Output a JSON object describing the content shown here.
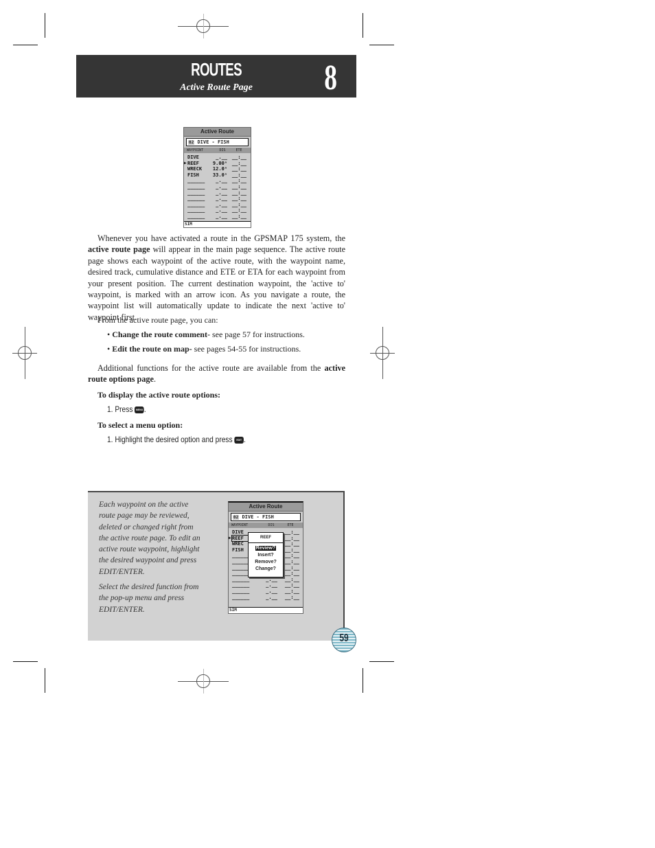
{
  "header": {
    "title": "ROUTES",
    "subtitle": "Active Route Page",
    "chapter_number": "8"
  },
  "screen1": {
    "title": "Active Route",
    "route_number": "02",
    "route_name": "DIVE  - FISH",
    "columns": [
      "WAYPOINT",
      "DIS",
      "ETE"
    ],
    "rows": [
      {
        "arrow": "",
        "name": "DIVE",
        "dis": "_.__",
        "ete": "__:__"
      },
      {
        "arrow": "▶",
        "name": "REEF",
        "dis": "9.00ⁿ",
        "ete": "__:__"
      },
      {
        "arrow": "",
        "name": "WRECK",
        "dis": "12.0ⁿ",
        "ete": "__:__"
      },
      {
        "arrow": "",
        "name": "FISH",
        "dis": "33.0ⁿ",
        "ete": "__:__"
      },
      {
        "arrow": "",
        "name": "______",
        "dis": "_.__",
        "ete": "__:__"
      },
      {
        "arrow": "",
        "name": "______",
        "dis": "_.__",
        "ete": "__:__"
      },
      {
        "arrow": "",
        "name": "______",
        "dis": "_.__",
        "ete": "__:__"
      },
      {
        "arrow": "",
        "name": "______",
        "dis": "_.__",
        "ete": "__:__"
      },
      {
        "arrow": "",
        "name": "______",
        "dis": "_.__",
        "ete": "__:__"
      },
      {
        "arrow": "",
        "name": "______",
        "dis": "_.__",
        "ete": "__:__"
      },
      {
        "arrow": "",
        "name": "______",
        "dis": "_.__",
        "ete": "__:__"
      },
      {
        "arrow": "",
        "name": "______",
        "dis": "_.__",
        "ete": "__:__"
      }
    ],
    "status": "SIM"
  },
  "intro": {
    "p1_lead": "Whenever you have activated a route in the GPSMAP 175 system, the ",
    "p1_bold": "active route page",
    "p1_rest": " will appear in the main page sequence. The active route page shows each waypoint of the active route, with the waypoint name, desired track, cumulative distance and ETE or ETA for each waypoint from your present position. The current destination waypoint, the 'active to' waypoint, is marked with an arrow icon. As you navigate a route, the waypoint list will automatically update to indicate the next 'active to' waypoint first.",
    "from_text": "From the active route page, you can:",
    "bullets": [
      {
        "bold": "Change the route comment-",
        "text": " see page 57 for instructions."
      },
      {
        "bold": "Edit the route on map-",
        "text": " see pages 54-55 for instructions."
      }
    ],
    "p2_lead": "Additional functions for the active route are available from the ",
    "p2_bold": "active route options page",
    "p2_end": "."
  },
  "procedures": [
    {
      "heading": "To display the active route options:",
      "step": "1. Press ",
      "key": "MENU",
      "end": "."
    },
    {
      "heading": "To select a menu option:",
      "step": "1. Highlight the desired option and press ",
      "key": "EDIT ENTER",
      "end": "."
    }
  ],
  "sidebar": {
    "caption1": "Each waypoint on the active route page may be reviewed, deleted or changed right from the active route page. To edit an active route waypoint, highlight the desired waypoint and press EDIT/ENTER.",
    "caption2": "Select the desired function from the pop-up menu and press EDIT/ENTER."
  },
  "screen2": {
    "title": "Active Route",
    "route_number": "02",
    "route_name": "DIVE  - FISH",
    "columns": [
      "WAYPOINT",
      "DIS",
      "ETE"
    ],
    "rows": [
      {
        "arrow": "",
        "name": "DIVE",
        "dis": "",
        "ete": "__:__"
      },
      {
        "arrow": "▶",
        "name": "REEF",
        "dis": "",
        "ete": "__:__"
      },
      {
        "arrow": "",
        "name": "WREC",
        "dis": "",
        "ete": "__:__"
      },
      {
        "arrow": "",
        "name": "FISH",
        "dis": "",
        "ete": "__:__"
      },
      {
        "arrow": "",
        "name": "______",
        "dis": "_.__",
        "ete": "__:__"
      },
      {
        "arrow": "",
        "name": "______",
        "dis": "_.__",
        "ete": "__:__"
      },
      {
        "arrow": "",
        "name": "______",
        "dis": "_.__",
        "ete": "__:__"
      },
      {
        "arrow": "",
        "name": "______",
        "dis": "_.__",
        "ete": "__:__"
      },
      {
        "arrow": "",
        "name": "______",
        "dis": "_.__",
        "ete": "__:__"
      },
      {
        "arrow": "",
        "name": "______",
        "dis": "_.__",
        "ete": "__:__"
      },
      {
        "arrow": "",
        "name": "______",
        "dis": "_.__",
        "ete": "__:__"
      },
      {
        "arrow": "",
        "name": "______",
        "dis": "_.__",
        "ete": "__:__"
      }
    ],
    "status": "SIM",
    "popup": {
      "title": "REEF",
      "options": [
        "Review?",
        "Insert?",
        "Remove?",
        "Change?"
      ],
      "selected": 0
    }
  },
  "page_number": "59"
}
